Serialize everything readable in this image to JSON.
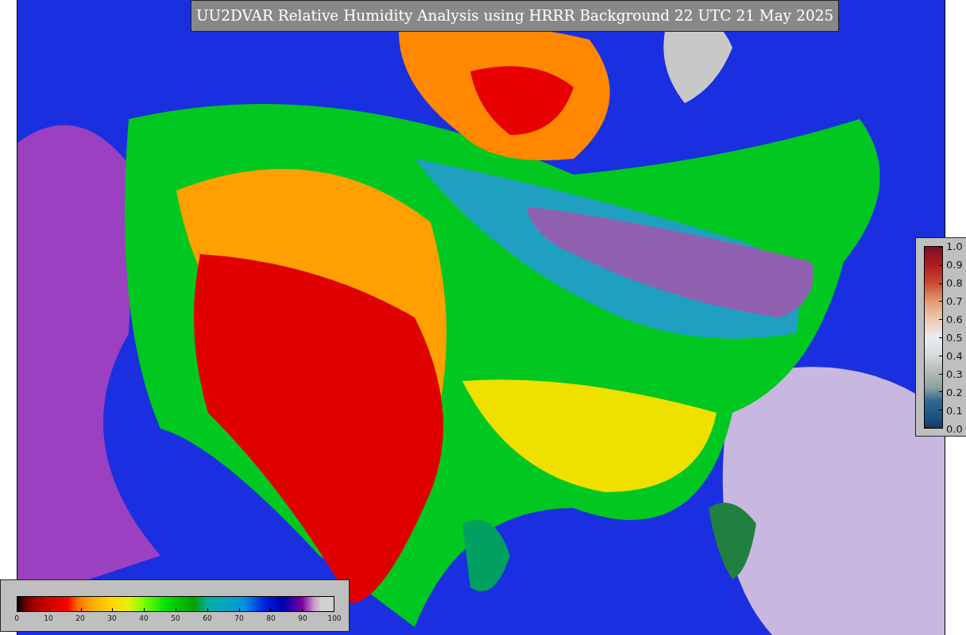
{
  "title": "UU2DVAR Relative Humidity Analysis using HRRR Background 22 UTC 21 May 2025",
  "humidity_legend": {
    "ticks": [
      "0",
      "10",
      "20",
      "30",
      "40",
      "50",
      "60",
      "70",
      "80",
      "90",
      "100"
    ]
  },
  "observation_legend": {
    "ticks": [
      "1.0",
      "0.9",
      "0.8",
      "0.7",
      "0.6",
      "0.5",
      "0.4",
      "0.3",
      "0.2",
      "0.1",
      "0.0"
    ]
  }
}
